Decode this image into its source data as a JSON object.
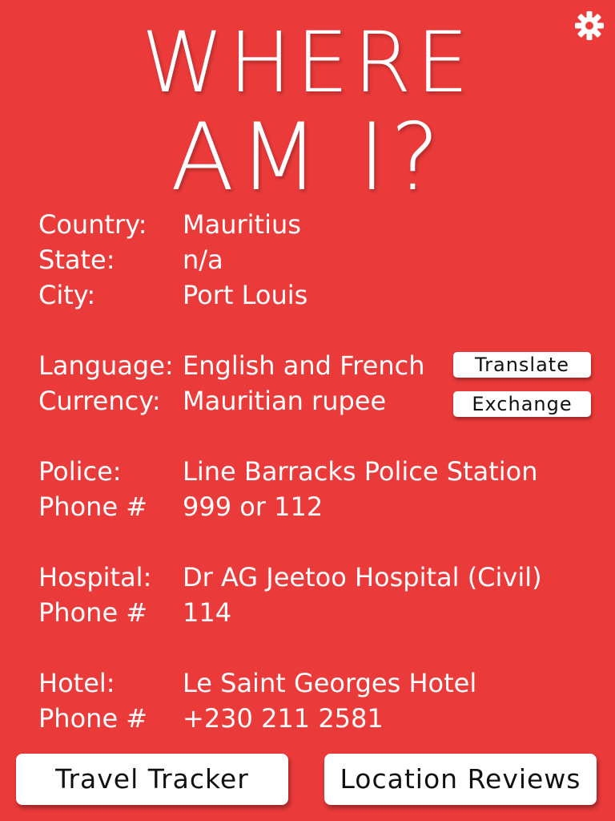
{
  "app": {
    "title_line1": "WHERE",
    "title_line2": "AM I?",
    "background_color": "#eb3a3a",
    "settings_icon": "gear-icon"
  },
  "location": {
    "country_label": "Country:",
    "country_value": "Mauritius",
    "state_label": "State:",
    "state_value": "n/a",
    "city_label": "City:",
    "city_value": "Port Louis"
  },
  "culture": {
    "language_label": "Language:",
    "language_value": "English and French",
    "translate_label": "Translate",
    "currency_label": "Currency:",
    "currency_value": "Mauritian rupee",
    "exchange_label": "Exchange"
  },
  "police": {
    "label": "Police:",
    "value": "Line Barracks Police Station",
    "phone_label": "Phone #",
    "phone_value": "999 or 112"
  },
  "hospital": {
    "label": "Hospital:",
    "value": "Dr AG Jeetoo Hospital (Civil)",
    "phone_label": "Phone #",
    "phone_value": "114"
  },
  "hotel": {
    "label": "Hotel:",
    "value": "Le Saint Georges Hotel",
    "phone_label": "Phone #",
    "phone_value": "+230 211 2581"
  },
  "footer": {
    "travel_tracker_label": "Travel Tracker",
    "location_reviews_label": "Location Reviews"
  }
}
